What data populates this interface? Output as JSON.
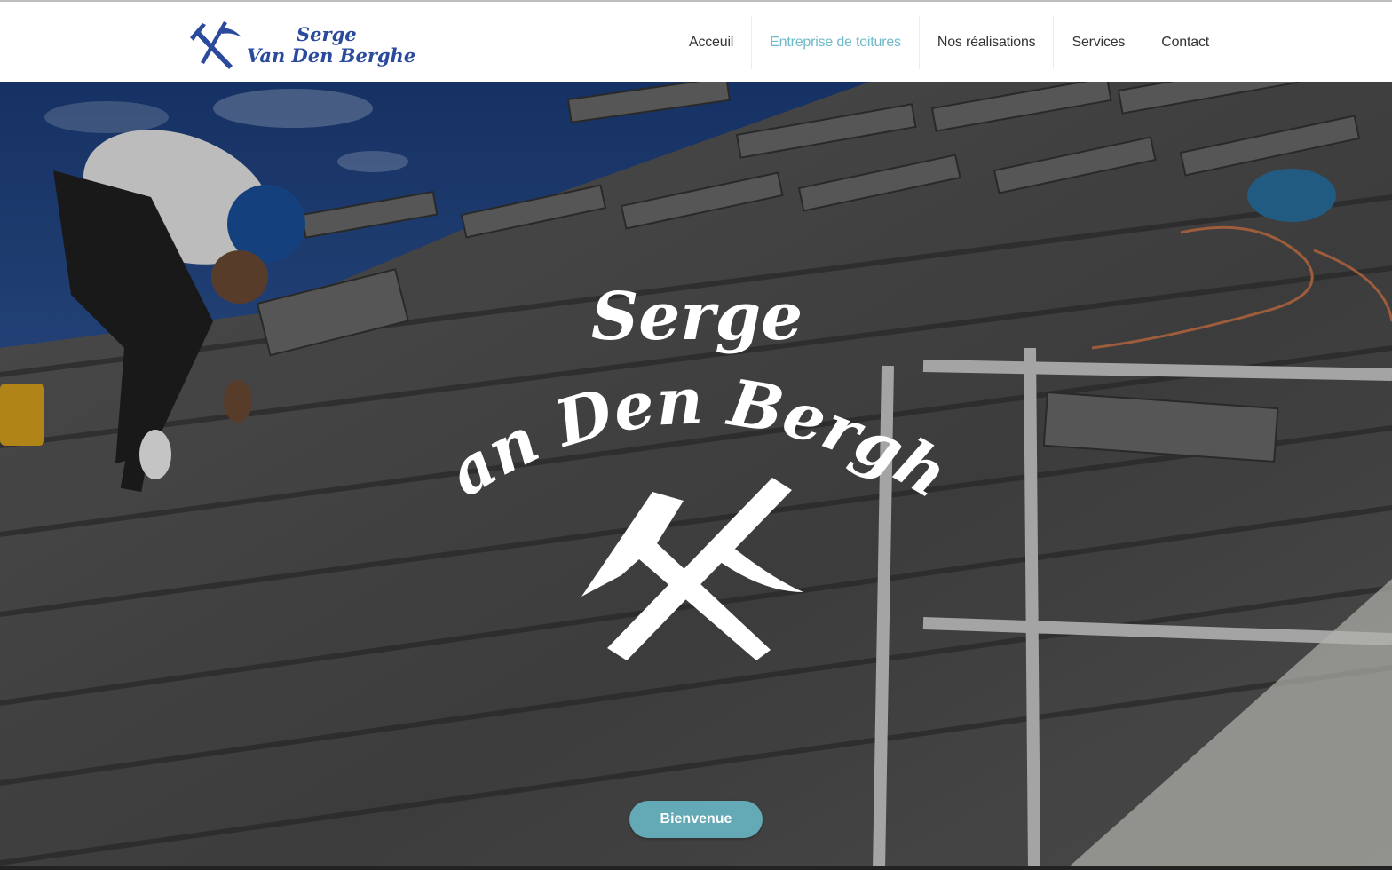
{
  "brand": {
    "line1": "Serge",
    "line2": "Van Den Berghe",
    "logo_color": "#2a4a9c",
    "logo_icon": "crossed-hammers-icon"
  },
  "nav": {
    "items": [
      {
        "label": "Acceuil",
        "active": false
      },
      {
        "label": "Entreprise de toitures",
        "active": true
      },
      {
        "label": "Nos réalisations",
        "active": false
      },
      {
        "label": "Services",
        "active": false
      },
      {
        "label": "Contact",
        "active": false
      }
    ],
    "active_color": "#6fbac9"
  },
  "hero": {
    "title_line1": "Serge",
    "title_line2": "Van Den Berghe",
    "emblem_icon": "crossed-hammers-icon",
    "button_label": "Bienvenue",
    "button_color": "#63a9b6"
  }
}
